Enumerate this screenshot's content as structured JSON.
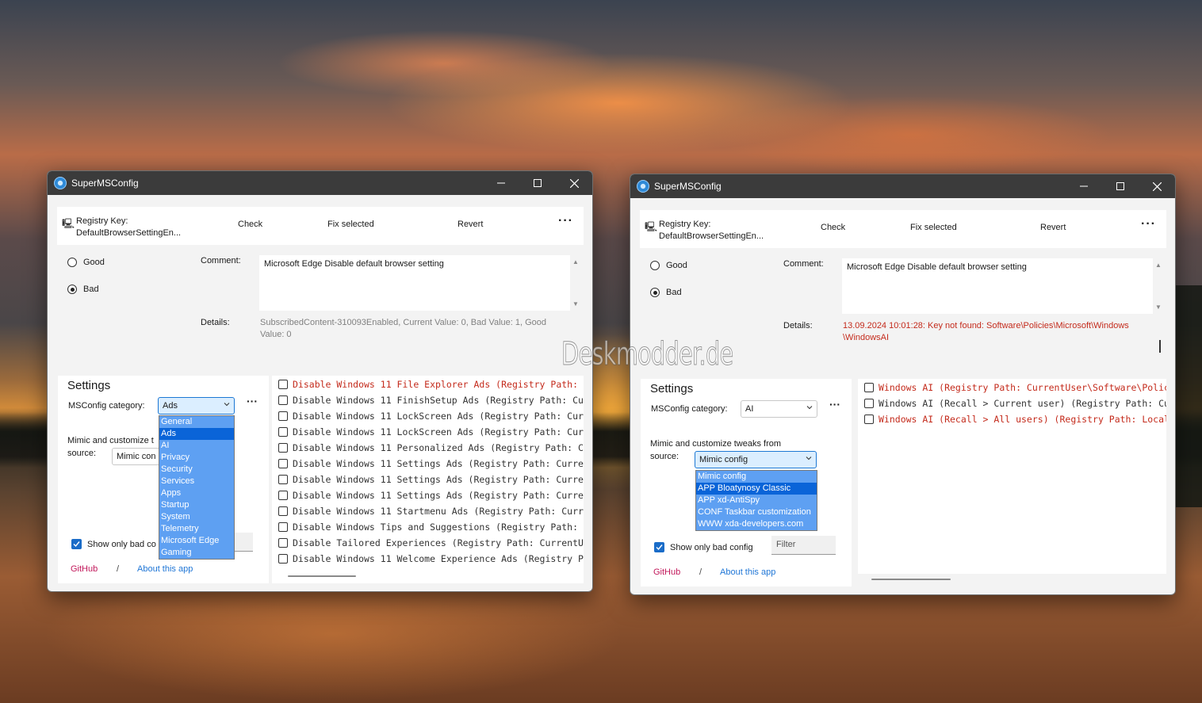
{
  "watermark": "Deskmodder.de",
  "left": {
    "title": "SuperMSConfig",
    "registry_label": "Registry Key:",
    "registry_value": "DefaultBrowserSettingEn...",
    "check": "Check",
    "fix": "Fix selected",
    "revert": "Revert",
    "more": "···",
    "good": "Good",
    "bad": "Bad",
    "comment_label": "Comment:",
    "comment": "Microsoft Edge Disable default browser setting",
    "details_label": "Details:",
    "details": "SubscribedContent-310093Enabled, Current Value: 0, Bad Value: 1, Good Value: 0",
    "settings": "Settings",
    "category_label": "MSConfig category:",
    "category_value": "Ads",
    "category_options": [
      "General",
      "Ads",
      "AI",
      "Privacy",
      "Security",
      "Services",
      "Apps",
      "Startup",
      "System",
      "Telemetry",
      "Microsoft Edge",
      "Gaming"
    ],
    "category_selected": "Ads",
    "mimic_label_1": "Mimic and customize t",
    "mimic_label_2": "source:",
    "mimic_value": "Mimic con",
    "show_bad": "Show only bad co",
    "github": "GitHub",
    "slash": "/",
    "about": "About this app",
    "tweaks": [
      "Disable Windows 11 File Explorer Ads (Registry Path:",
      "Disable Windows 11 FinishSetup Ads (Registry Path: Cu",
      "Disable Windows 11 LockScreen Ads (Registry Path: Cur",
      "Disable Windows 11 LockScreen Ads (Registry Path: Cur",
      "Disable Windows 11 Personalized Ads (Registry Path: C",
      "Disable Windows 11 Settings Ads (Registry Path: Curre",
      "Disable Windows 11 Settings Ads (Registry Path: Curre",
      "Disable Windows 11 Settings Ads (Registry Path: Curre",
      "Disable Windows 11 Startmenu Ads (Registry Path: Curr",
      "Disable Windows Tips and Suggestions (Registry Path:",
      "Disable Tailored Experiences (Registry Path: CurrentU",
      "Disable Windows 11 Welcome Experience Ads (Registry P"
    ]
  },
  "right": {
    "title": "SuperMSConfig",
    "registry_label": "Registry Key:",
    "registry_value": "DefaultBrowserSettingEn...",
    "check": "Check",
    "fix": "Fix selected",
    "revert": "Revert",
    "more": "···",
    "good": "Good",
    "bad": "Bad",
    "comment_label": "Comment:",
    "comment": "Microsoft Edge Disable default browser setting",
    "details_label": "Details:",
    "details": "13.09.2024 10:01:28: Key not found: Software\\Policies\\Microsoft\\Windows \\WindowsAI",
    "settings": "Settings",
    "category_label": "MSConfig category:",
    "category_value": "AI",
    "mimic_label_1": "Mimic and customize tweaks from",
    "mimic_label_2": "source:",
    "mimic_value": "Mimic config",
    "mimic_options": [
      "Mimic config",
      "APP Bloatynosy Classic",
      "APP xd-AntiSpy",
      "CONF Taskbar customization",
      "WWW xda-developers.com"
    ],
    "mimic_selected": "APP Bloatynosy Classic",
    "show_bad": "Show only bad config",
    "filter_placeholder": "Filter",
    "github": "GitHub",
    "slash": "/",
    "about": "About this app",
    "tweaks": [
      "Windows AI (Registry Path: CurrentUser\\Software\\Polic",
      "Windows AI (Recall > Current user) (Registry Path: Cu",
      "Windows AI (Recall > All users) (Registry Path: Local"
    ],
    "tweak_states": [
      "bad",
      "normal",
      "bad"
    ]
  },
  "colors": {
    "accent": "#1a6cc8",
    "error": "#c42b1c",
    "dropdown": "#5ea0f2",
    "dropdown_selected": "#0a64d8",
    "github": "#c2185b",
    "link": "#1f76d6"
  }
}
